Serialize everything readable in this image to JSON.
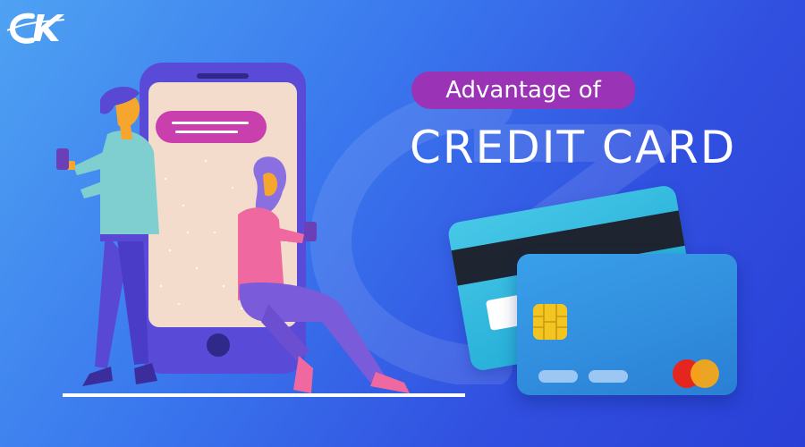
{
  "brand": {
    "logo_text": "CK"
  },
  "heading": {
    "pill_text": "Advantage of",
    "title": "CREDIT CARD"
  },
  "colors": {
    "background_start": "#4ea2f2",
    "background_end": "#2a3fd6",
    "pill": "#9b33b7",
    "phone_body": "#5a4ad8",
    "phone_screen": "#f3dccb",
    "chat_bubble": "#c93fae",
    "back_card": "#1aa6d2",
    "front_card": "#2a7fd4",
    "chip": "#f2c521",
    "mastercard_red": "#e5261f",
    "mastercard_yellow": "#f6a71b"
  },
  "icons": [
    "ck-logo-icon",
    "chip-icon",
    "mastercard-logo-icon"
  ]
}
